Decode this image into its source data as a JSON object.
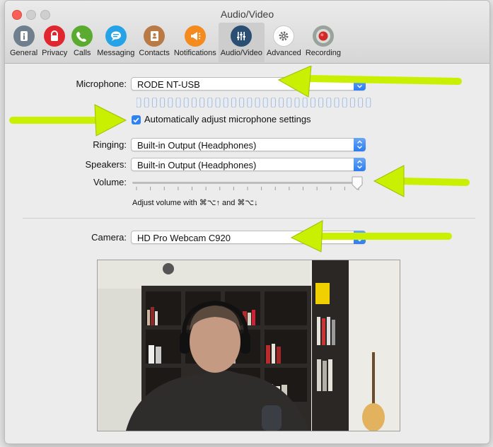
{
  "window": {
    "title": "Audio/Video"
  },
  "toolbar": {
    "items": [
      {
        "label": "General",
        "icon": "general-icon"
      },
      {
        "label": "Privacy",
        "icon": "lock-icon"
      },
      {
        "label": "Calls",
        "icon": "phone-icon"
      },
      {
        "label": "Messaging",
        "icon": "chat-bubble-icon"
      },
      {
        "label": "Contacts",
        "icon": "contacts-book-icon"
      },
      {
        "label": "Notifications",
        "icon": "megaphone-icon"
      },
      {
        "label": "Audio/Video",
        "icon": "mixer-icon"
      },
      {
        "label": "Advanced",
        "icon": "gear-icon"
      },
      {
        "label": "Recording",
        "icon": "record-button-icon"
      }
    ],
    "active": "Audio/Video"
  },
  "microphone": {
    "label": "Microphone:",
    "value": "RODE NT-USB",
    "auto_adjust_label": "Automatically adjust microphone settings",
    "auto_adjust_checked": true
  },
  "ringing": {
    "label": "Ringing:",
    "value": "Built-in Output (Headphones)"
  },
  "speakers": {
    "label": "Speakers:",
    "value": "Built-in Output (Headphones)"
  },
  "volume": {
    "label": "Volume:",
    "hint": "Adjust volume with ⌘⌥↑ and ⌘⌥↓",
    "level": 1.0
  },
  "camera": {
    "label": "Camera:",
    "value": "HD Pro Webcam C920"
  },
  "colors": {
    "accent": "#2f82f6",
    "arrow": "#c8f000"
  }
}
